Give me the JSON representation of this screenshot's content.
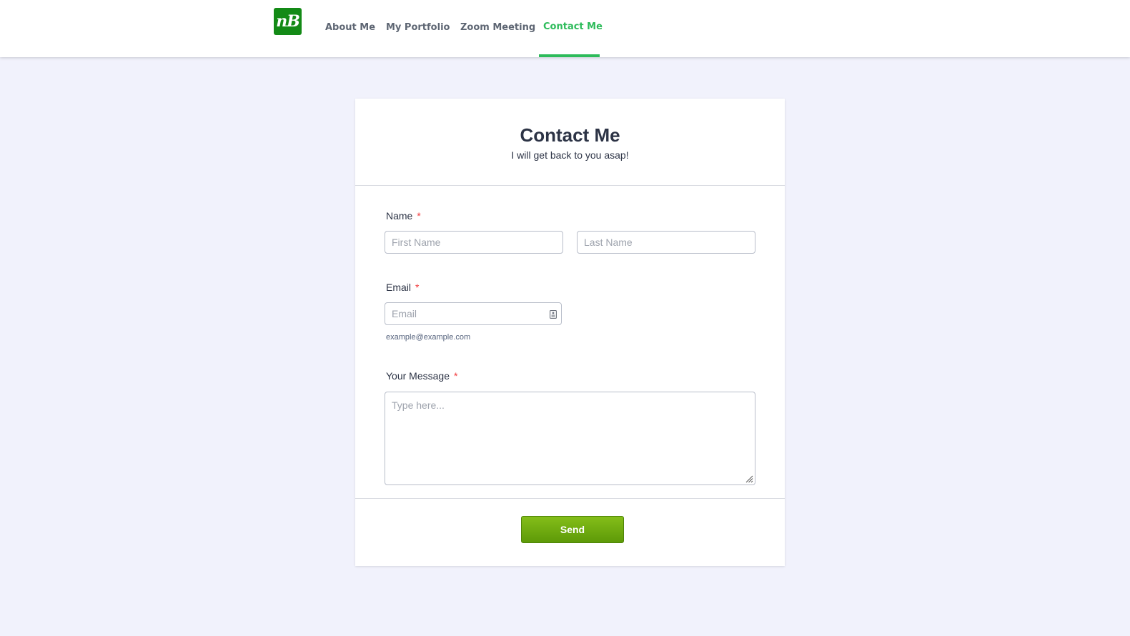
{
  "header": {
    "logo_text": "nB",
    "nav": [
      {
        "label": "About Me"
      },
      {
        "label": "My Portfolio"
      },
      {
        "label": "Zoom Meeting"
      },
      {
        "label": "Contact Me",
        "active": true
      }
    ]
  },
  "form": {
    "title": "Contact Me",
    "subtitle": "I will get back to you asap!",
    "name": {
      "label": "Name",
      "required_mark": "*",
      "first_placeholder": "First Name",
      "last_placeholder": "Last Name",
      "first_value": "",
      "last_value": ""
    },
    "email": {
      "label": "Email",
      "required_mark": "*",
      "placeholder": "Email",
      "value": "",
      "sublabel": "example@example.com",
      "icon": "contact-card-icon"
    },
    "message": {
      "label": "Your Message",
      "required_mark": "*",
      "placeholder": "Type here...",
      "value": ""
    },
    "submit_label": "Send"
  },
  "colors": {
    "page_bg": "#f1f2fc",
    "brand_green": "#138a16",
    "nav_active": "#2dbb5a",
    "nav_text": "#5e6673",
    "button_top": "#84be19",
    "button_bottom": "#5d9a08",
    "required": "#f23a3c",
    "text": "#2c3345"
  }
}
